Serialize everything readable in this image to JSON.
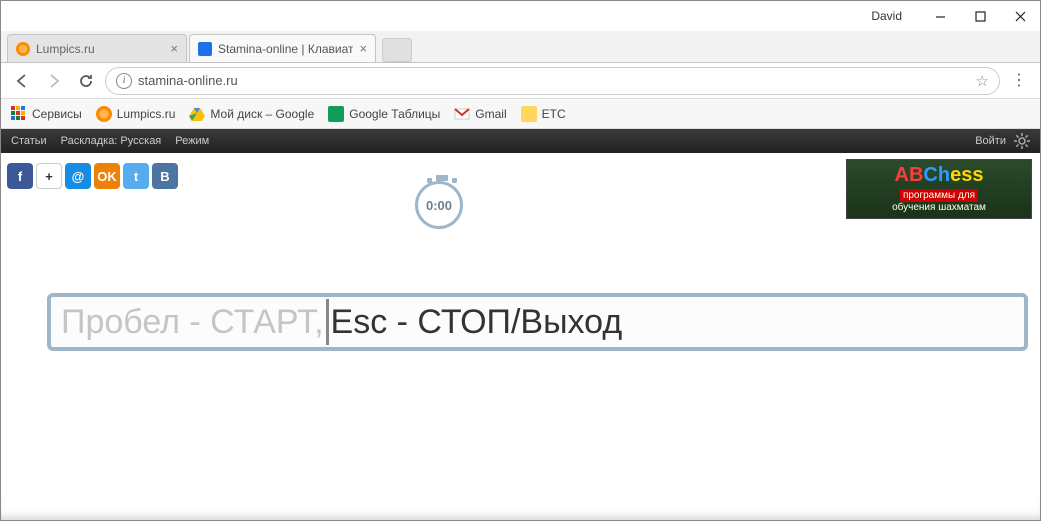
{
  "window": {
    "user": "David"
  },
  "tabs": [
    {
      "title": "Lumpics.ru",
      "favicon_color": "#ff8a00"
    },
    {
      "title": "Stamina-online | Клавиат",
      "favicon_color": "#1a73e8"
    }
  ],
  "address": {
    "url": "stamina-online.ru"
  },
  "bookmarks": {
    "apps": "Сервисы",
    "items": [
      {
        "label": "Lumpics.ru"
      },
      {
        "label": "Мой диск – Google"
      },
      {
        "label": "Google Таблицы"
      },
      {
        "label": "Gmail"
      },
      {
        "label": "ETC"
      }
    ]
  },
  "app_menu": {
    "left": [
      "Статьи",
      "Раскладка: Русская",
      "Режим"
    ],
    "login": "Войти"
  },
  "socials": [
    "f",
    "+",
    "@",
    "OK",
    "t",
    "B"
  ],
  "banner": {
    "title_parts": [
      "AB",
      "Ch",
      "ess"
    ],
    "sub1": "программы для",
    "sub2": "обучения шахматам"
  },
  "stopwatch": {
    "time": "0:00"
  },
  "typing": {
    "left": "Пробел - СТАРТ, ",
    "right": "Esc - СТОП/Выход"
  }
}
